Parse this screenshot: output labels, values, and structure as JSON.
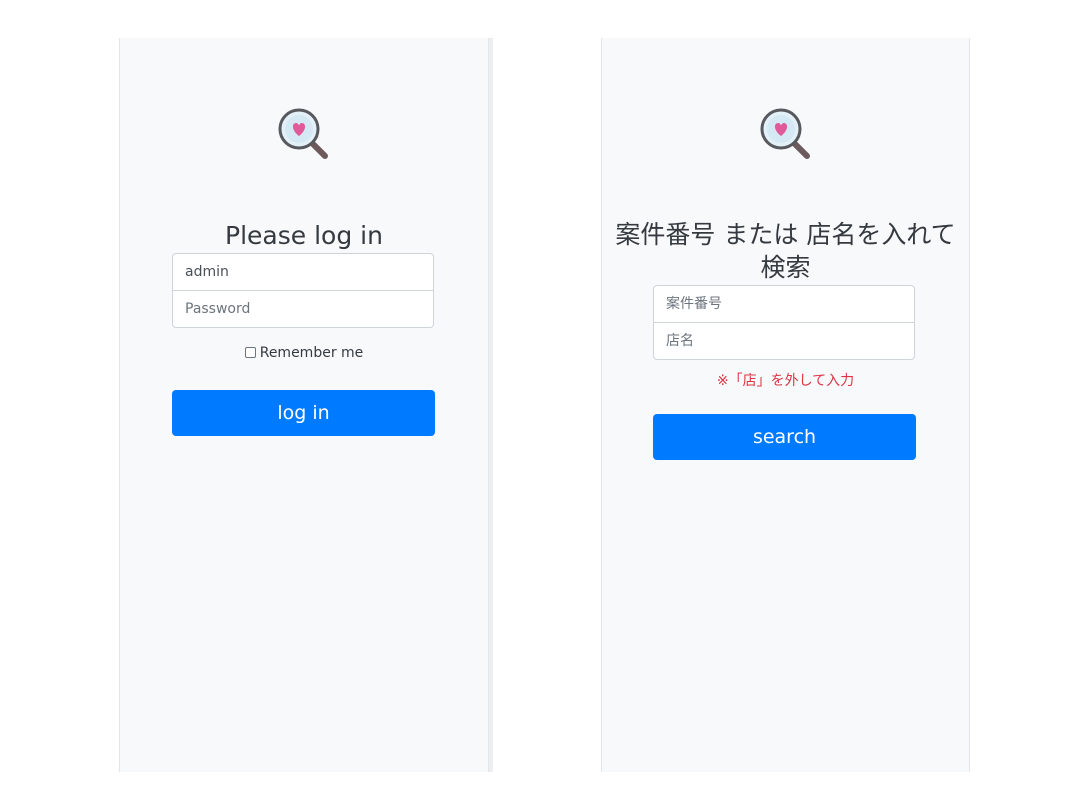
{
  "login": {
    "title": "Please log in",
    "username_value": "admin",
    "password_placeholder": "Password",
    "remember_label": "Remember me",
    "submit_label": "log in"
  },
  "search": {
    "title": "案件番号 または 店名を入れて検索",
    "case_number_placeholder": "案件番号",
    "store_name_placeholder": "店名",
    "note": "※「店」を外して入力",
    "submit_label": "search"
  },
  "colors": {
    "accent": "#007bff",
    "panel_background": "#f8f9fa",
    "note_text": "#dc3545",
    "logo_heart": "#e05a9a"
  },
  "icons": {
    "logo": "magnifier-heart-icon",
    "checkbox": "checkbox-icon"
  }
}
